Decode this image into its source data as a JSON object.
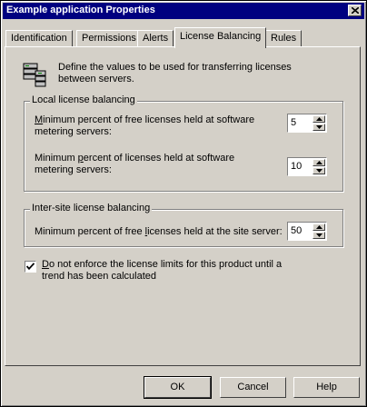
{
  "window": {
    "title": "Example application Properties"
  },
  "tabs": [
    {
      "label": "Identification"
    },
    {
      "label": "Permissions"
    },
    {
      "label": "Alerts"
    },
    {
      "label": "License Balancing"
    },
    {
      "label": "Rules"
    }
  ],
  "intro": {
    "text_line1": "Define the values to be used for transferring licenses",
    "text_line2": "between servers."
  },
  "local_group": {
    "label": "Local license balancing",
    "field1": {
      "line1_pre": "M",
      "line1_rest": "inimum percent of free licenses held at software",
      "line2": "metering servers:",
      "value": "5"
    },
    "field2": {
      "line1_pre": "Minimum ",
      "line1_u": "p",
      "line1_rest": "ercent of licenses held at software",
      "line2": "metering servers:",
      "value": "10"
    }
  },
  "intersite_group": {
    "label": "Inter-site license balancing",
    "field": {
      "pre": "Minimum percent of free ",
      "u": "l",
      "rest": "icenses held at the site server:",
      "value": "50"
    }
  },
  "enforce": {
    "u": "D",
    "line1_rest": "o not enforce the license limits for this product until a",
    "line2": "trend has been calculated",
    "checked": true
  },
  "buttons": {
    "ok": "OK",
    "cancel": "Cancel",
    "help": "Help"
  }
}
